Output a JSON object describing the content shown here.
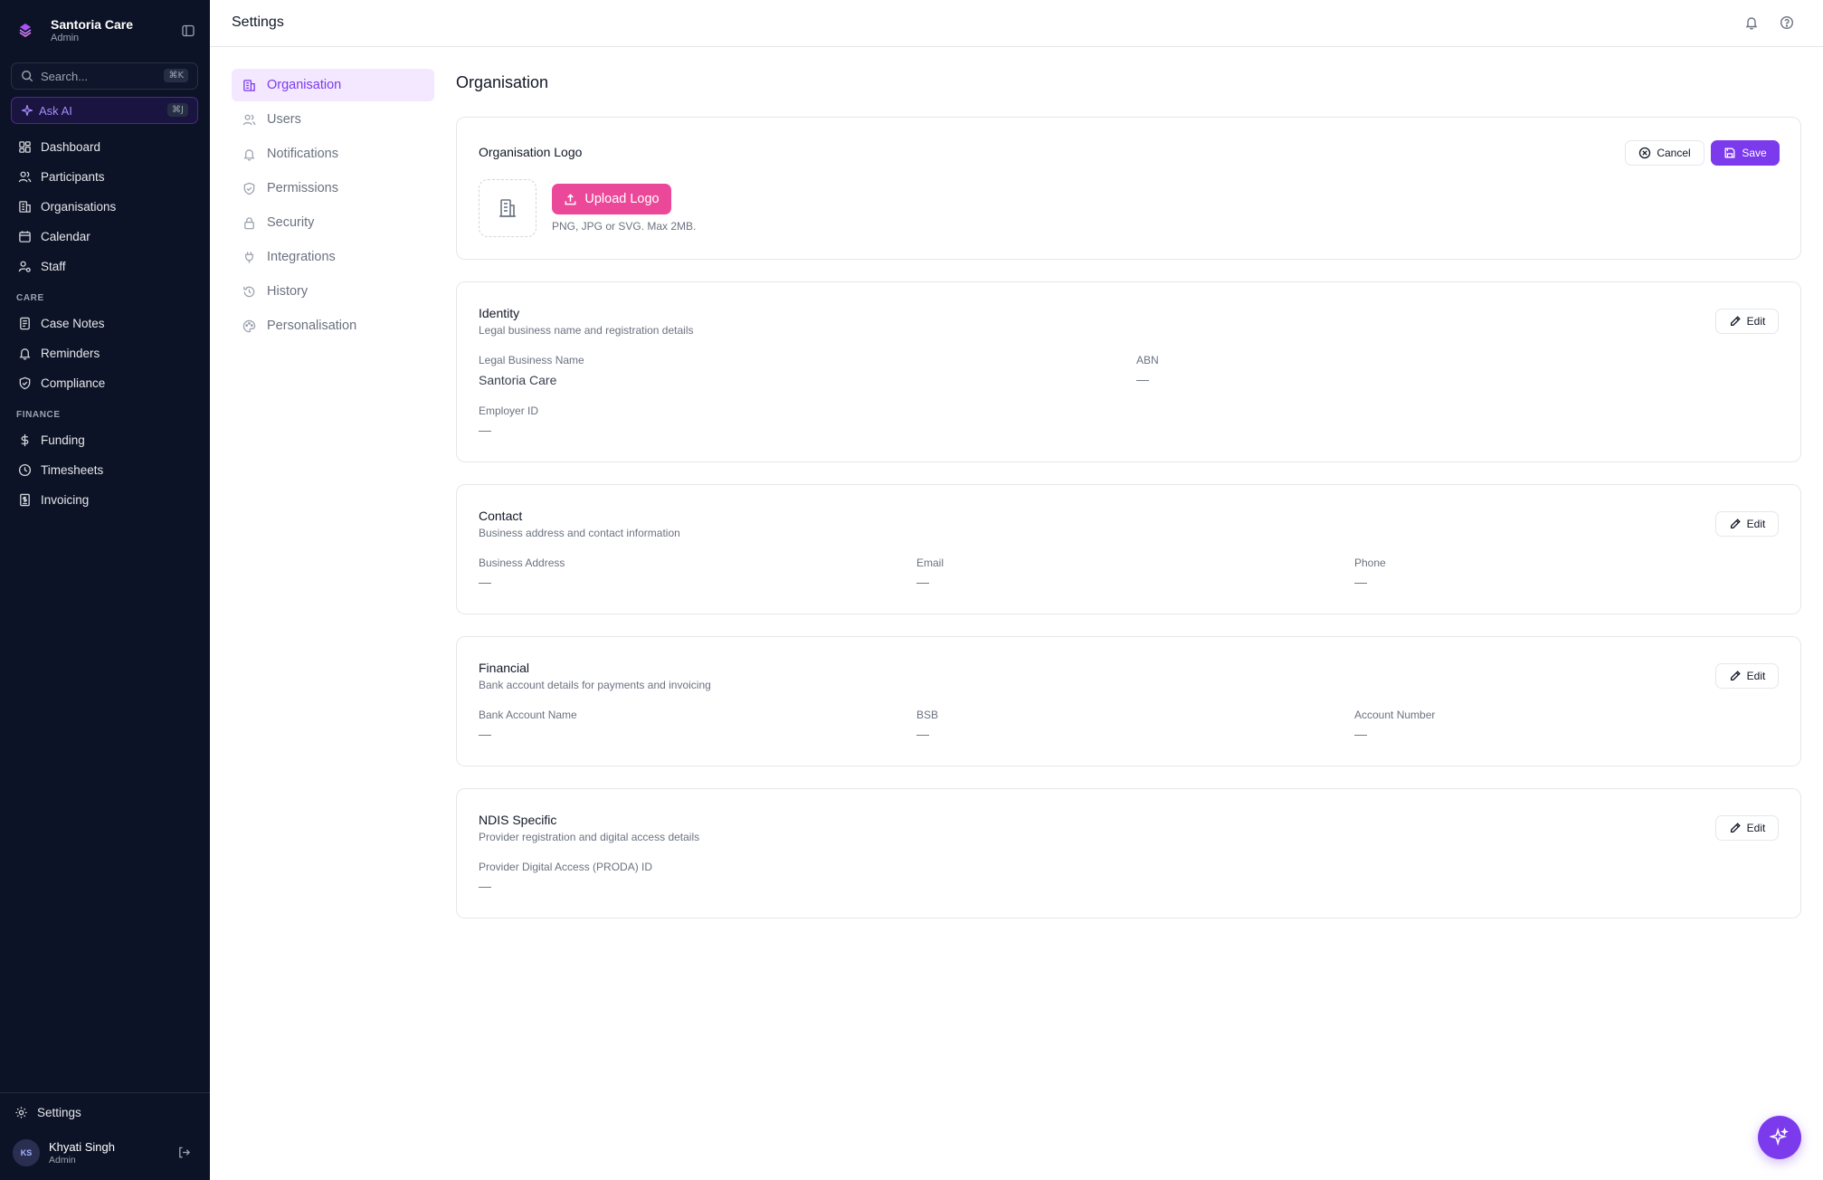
{
  "sidebar": {
    "brand_name": "Santoria Care",
    "brand_role": "Admin",
    "search_placeholder": "Search...",
    "search_shortcut": "⌘K",
    "ask_ai_label": "Ask AI",
    "ask_ai_shortcut": "⌘J",
    "main_items": [
      {
        "label": "Dashboard",
        "icon": "dashboard-icon"
      },
      {
        "label": "Participants",
        "icon": "users-icon"
      },
      {
        "label": "Organisations",
        "icon": "building-icon"
      },
      {
        "label": "Calendar",
        "icon": "calendar-icon"
      },
      {
        "label": "Staff",
        "icon": "staff-icon"
      }
    ],
    "care_section": "CARE",
    "care_items": [
      {
        "label": "Case Notes",
        "icon": "notes-icon"
      },
      {
        "label": "Reminders",
        "icon": "bell-icon"
      },
      {
        "label": "Compliance",
        "icon": "shield-check-icon"
      }
    ],
    "finance_section": "FINANCE",
    "finance_items": [
      {
        "label": "Funding",
        "icon": "dollar-icon"
      },
      {
        "label": "Timesheets",
        "icon": "clock-icon"
      },
      {
        "label": "Invoicing",
        "icon": "invoice-icon"
      }
    ],
    "settings_label": "Settings",
    "user": {
      "initials": "KS",
      "name": "Khyati Singh",
      "role": "Admin"
    }
  },
  "header": {
    "title": "Settings"
  },
  "settings_nav": {
    "items": [
      {
        "label": "Organisation",
        "active": true
      },
      {
        "label": "Users"
      },
      {
        "label": "Notifications"
      },
      {
        "label": "Permissions"
      },
      {
        "label": "Security"
      },
      {
        "label": "Integrations"
      },
      {
        "label": "History"
      },
      {
        "label": "Personalisation"
      }
    ]
  },
  "main": {
    "title": "Organisation",
    "logo_card": {
      "title": "Organisation Logo",
      "upload_label": "Upload Logo",
      "hint": "PNG, JPG or SVG. Max 2MB.",
      "cancel_label": "Cancel",
      "save_label": "Save"
    },
    "identity": {
      "title": "Identity",
      "subtitle": "Legal business name and registration details",
      "edit_label": "Edit",
      "legal_name_label": "Legal Business Name",
      "legal_name_value": "Santoria Care",
      "abn_label": "ABN",
      "abn_value": "—",
      "employer_id_label": "Employer ID",
      "employer_id_value": "—"
    },
    "contact": {
      "title": "Contact",
      "subtitle": "Business address and contact information",
      "edit_label": "Edit",
      "address_label": "Business Address",
      "address_value": "—",
      "email_label": "Email",
      "email_value": "—",
      "phone_label": "Phone",
      "phone_value": "—"
    },
    "financial": {
      "title": "Financial",
      "subtitle": "Bank account details for payments and invoicing",
      "edit_label": "Edit",
      "bank_name_label": "Bank Account Name",
      "bank_name_value": "—",
      "bsb_label": "BSB",
      "bsb_value": "—",
      "account_number_label": "Account Number",
      "account_number_value": "—"
    },
    "ndis": {
      "title": "NDIS Specific",
      "subtitle": "Provider registration and digital access details",
      "edit_label": "Edit",
      "proda_label": "Provider Digital Access (PRODA) ID",
      "proda_value": "—"
    }
  },
  "colors": {
    "sidebar_bg": "#0d1326",
    "accent": "#7c3aed",
    "upload_button": "#ec4899",
    "active_nav_bg": "#f3e8ff"
  }
}
